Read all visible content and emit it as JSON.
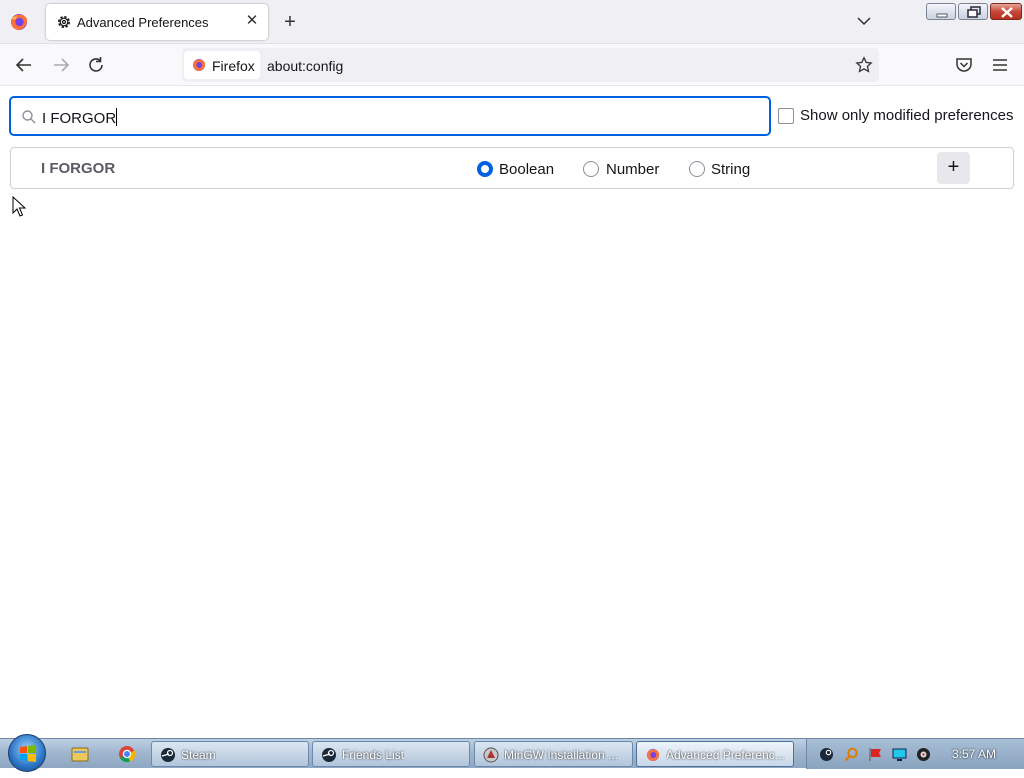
{
  "browser": {
    "tab_title": "Advanced Preferences",
    "identity_label": "Firefox",
    "url": "about:config"
  },
  "page": {
    "search_value": "I FORGOR",
    "show_modified_label": "Show only modified preferences",
    "new_pref_name": "I FORGOR",
    "type_options": [
      "Boolean",
      "Number",
      "String"
    ],
    "selected_type": "Boolean",
    "add_label": "+"
  },
  "taskbar": {
    "windows": [
      {
        "label": "Steam",
        "icon": "steam-icon"
      },
      {
        "label": "Friends List",
        "icon": "steam-icon"
      },
      {
        "label": "MinGW Installation ...",
        "icon": "mingw-icon"
      },
      {
        "label": "Advanced Preferenc...",
        "icon": "firefox-icon",
        "active": true
      }
    ],
    "clock": "3:57 AM"
  },
  "colors": {
    "accent": "#0061e0"
  }
}
